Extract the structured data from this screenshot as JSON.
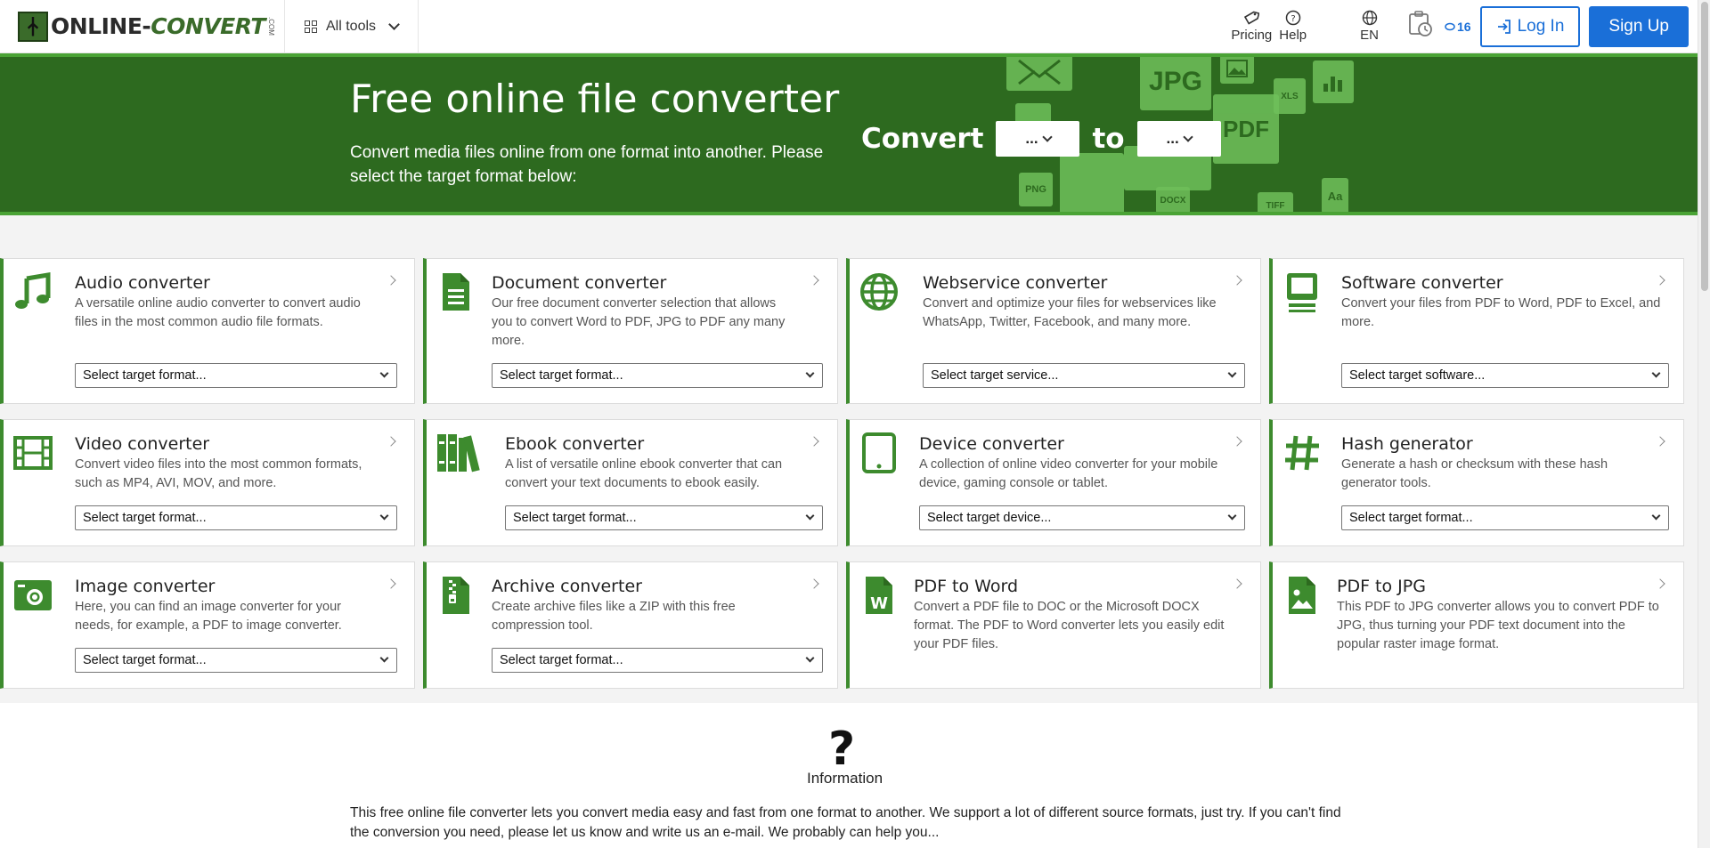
{
  "header": {
    "logo_text_1": "ONLINE-",
    "logo_text_2": "CONVERT",
    "logo_com": ".COM",
    "all_tools": "All tools",
    "pricing": "Pricing",
    "help": "Help",
    "language": "EN",
    "credits": "16",
    "login": "Log In",
    "signup": "Sign Up"
  },
  "hero": {
    "title": "Free online file converter",
    "subtitle": "Convert media files online from one format into another. Please select the target format below:",
    "convert_label": "Convert",
    "to_label": "to",
    "from_value": "...",
    "to_value": "...",
    "tiles": [
      "JPG",
      "PDF",
      "XLS",
      "PNG",
      "DOCX",
      "TIFF",
      "Aa"
    ]
  },
  "cards": [
    {
      "title": "Audio converter",
      "desc": "A versatile online audio converter to convert audio files in the most common audio file formats.",
      "select": "Select target format...",
      "icon": "music-note-icon"
    },
    {
      "title": "Document converter",
      "desc": "Our free document converter selection that allows you to convert Word to PDF, JPG to PDF any many more.",
      "select": "Select target format...",
      "icon": "document-icon"
    },
    {
      "title": "Webservice converter",
      "desc": "Convert and optimize your files for webservices like WhatsApp, Twitter, Facebook, and many more.",
      "select": "Select target service...",
      "icon": "globe-icon"
    },
    {
      "title": "Software converter",
      "desc": "Convert your files from PDF to Word, PDF to Excel, and more.",
      "select": "Select target software...",
      "icon": "monitor-icon"
    },
    {
      "title": "Video converter",
      "desc": "Convert video files into the most common formats, such as MP4, AVI, MOV, and more.",
      "select": "Select target format...",
      "icon": "film-icon"
    },
    {
      "title": "Ebook converter",
      "desc": "A list of versatile online ebook converter that can convert your text documents to ebook easily.",
      "select": "Select target format...",
      "icon": "books-icon"
    },
    {
      "title": "Device converter",
      "desc": "A collection of online video converter for your mobile device, gaming console or tablet.",
      "select": "Select target device...",
      "icon": "tablet-icon"
    },
    {
      "title": "Hash generator",
      "desc": "Generate a hash or checksum with these hash generator tools.",
      "select": "Select target format...",
      "icon": "hash-icon"
    },
    {
      "title": "Image converter",
      "desc": "Here, you can find an image converter for your needs, for example, a PDF to image converter.",
      "select": "Select target format...",
      "icon": "camera-icon"
    },
    {
      "title": "Archive converter",
      "desc": "Create archive files like a ZIP with this free compression tool.",
      "select": "Select target format...",
      "icon": "zip-file-icon"
    },
    {
      "title": "PDF to Word",
      "desc": "Convert a PDF file to DOC or the Microsoft DOCX format. The PDF to Word converter lets you easily edit your PDF files.",
      "select": "",
      "icon": "word-file-icon"
    },
    {
      "title": "PDF to JPG",
      "desc": "This PDF to JPG converter allows you to convert PDF to JPG, thus turning your PDF text document into the popular raster image format.",
      "select": "",
      "icon": "image-file-icon"
    }
  ],
  "info": {
    "label": "Information",
    "text": "This free online file converter lets you convert media easy and fast from one format to another. We support a lot of different source formats, just try. If you can't find the conversion you need, please let us know and write us an e-mail. We probably can help you..."
  },
  "colors": {
    "brand_green": "#2d6a1f",
    "accent_green": "#3d8b2e",
    "primary_blue": "#1a6fd8"
  }
}
